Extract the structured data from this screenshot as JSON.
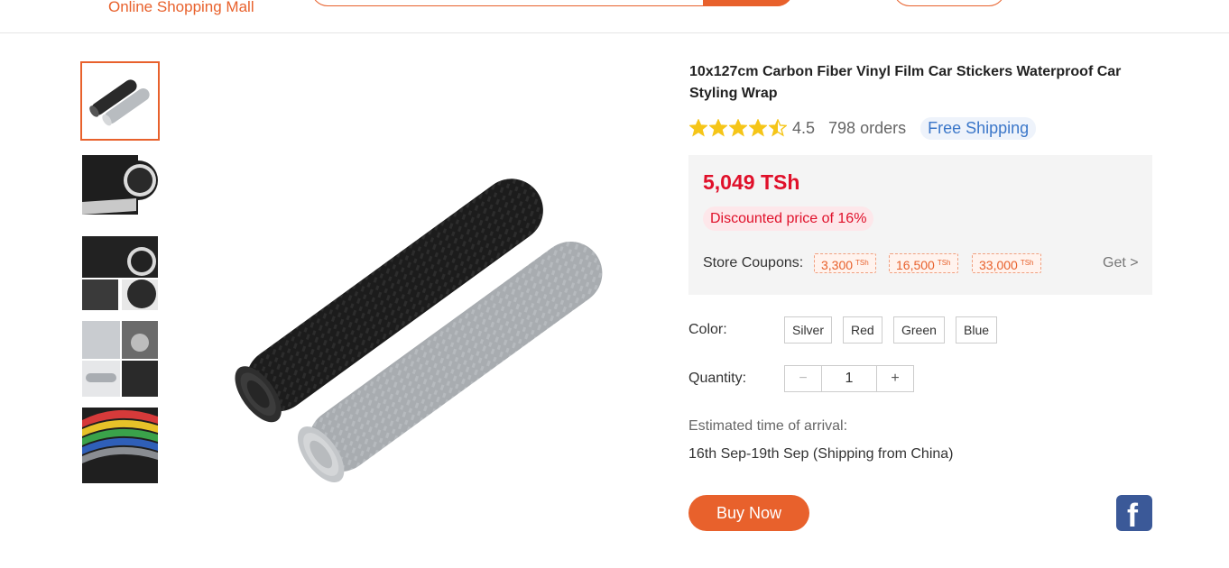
{
  "header": {
    "brand": "Online Shopping Mall"
  },
  "product": {
    "title": "10x127cm Carbon Fiber Vinyl Film Car Stickers Waterproof Car Styling Wrap",
    "rating": "4.5",
    "rating_value": 4.5,
    "orders": "798 orders",
    "free_shipping": "Free Shipping",
    "price": "5,049 TSh",
    "discount": "Discounted price of 16%",
    "coupons_label": "Store Coupons:",
    "coupons": [
      {
        "amount": "3,300",
        "unit": "TSh"
      },
      {
        "amount": "16,500",
        "unit": "TSh"
      },
      {
        "amount": "33,000",
        "unit": "TSh"
      }
    ],
    "get_label": "Get >",
    "color_label": "Color:",
    "colors": [
      "Silver",
      "Red",
      "Green",
      "Blue"
    ],
    "quantity_label": "Quantity:",
    "quantity": "1",
    "qty_minus": "−",
    "qty_plus": "+",
    "eta_label": "Estimated time of arrival:",
    "eta": "16th Sep-19th Sep (Shipping from China)",
    "buy_now": "Buy Now",
    "facebook_icon_glyph": "f"
  },
  "colors": {
    "accent": "#e8612c",
    "price_red": "#e0102a",
    "star": "#f5c518",
    "link_blue": "#3b77c9",
    "facebook": "#3b5998"
  }
}
